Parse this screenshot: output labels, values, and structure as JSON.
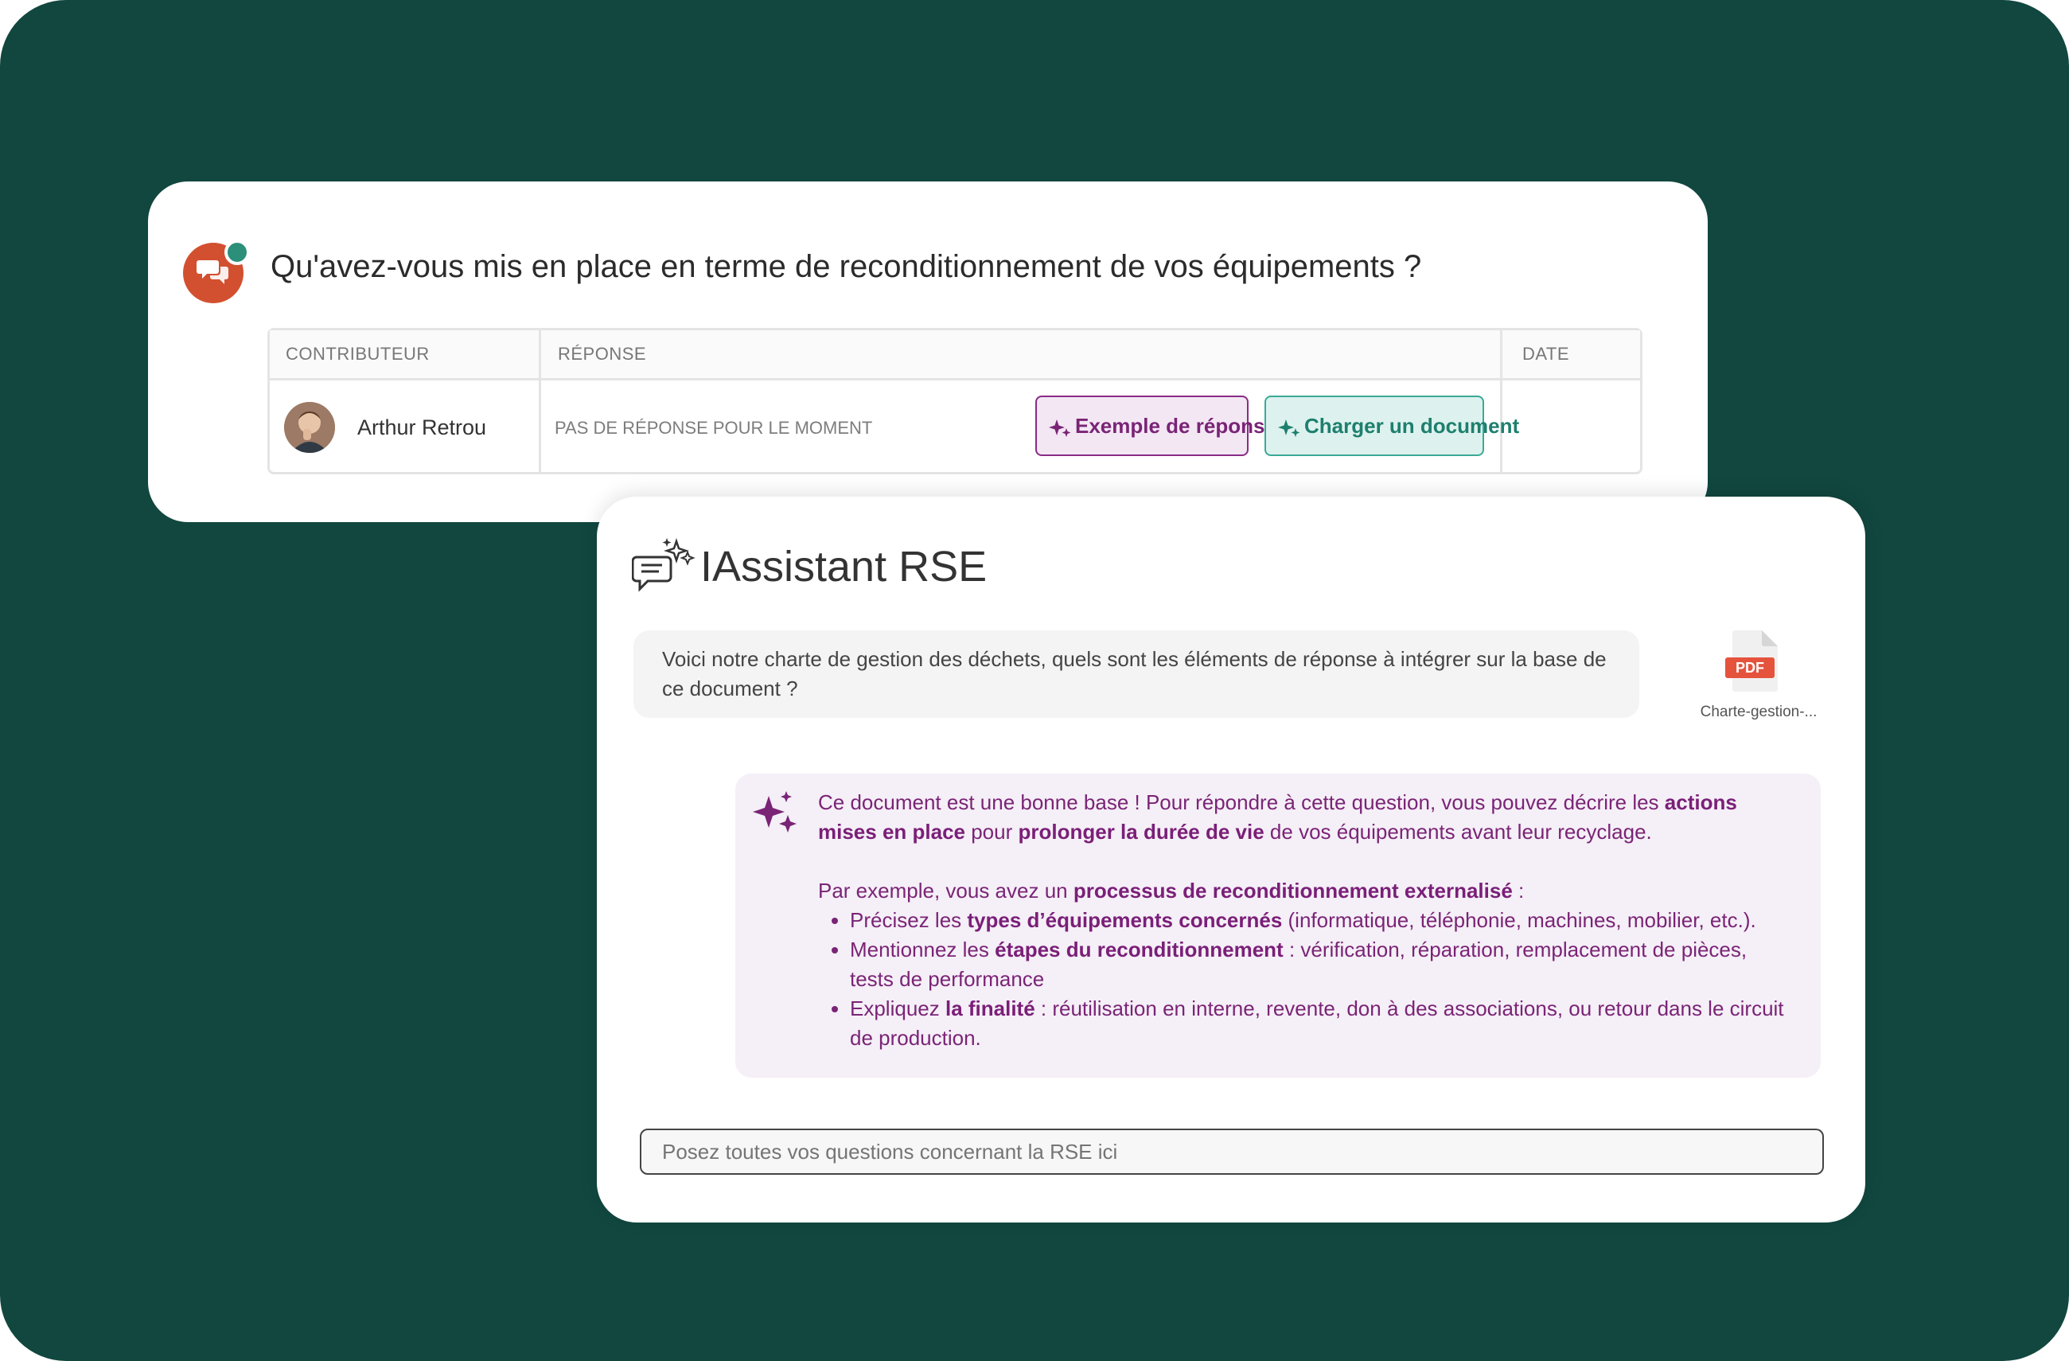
{
  "question": {
    "title": "Qu'avez-vous mis en place en terme de reconditionnement de vos équipements ?",
    "table": {
      "headers": [
        "CONTRIBUTEUR",
        "RÉPONSE",
        "DATE"
      ],
      "row": {
        "contributor": "Arthur Retrou",
        "response": "PAS DE RÉPONSE POUR LE MOMENT",
        "date": ""
      }
    },
    "buttons": {
      "example": "Exemple de réponse",
      "upload": "Charger un document"
    }
  },
  "assistant": {
    "title": "IAssistant RSE",
    "user_message": "Voici notre charte de gestion des déchets, quels sont les éléments de réponse à intégrer sur la base de ce document ?",
    "attachment": {
      "badge": "PDF",
      "filename": "Charte-gestion-..."
    },
    "reply": {
      "p1_a": "Ce document est une bonne base ! Pour répondre à cette question, vous pouvez décrire les ",
      "p1_b": "actions mises en place",
      "p1_c": " pour ",
      "p1_d": "prolonger la durée de vie",
      "p1_e": " de vos équipements avant leur recyclage.",
      "p2_a": "Par exemple, vous avez un ",
      "p2_b": "processus de reconditionnement externalisé",
      "p2_c": " :",
      "bullets": [
        {
          "a": "Précisez les ",
          "b": "types d’équipements concernés",
          "c": " (informatique, téléphonie, machines, mobilier, etc.)."
        },
        {
          "a": "Mentionnez les ",
          "b": "étapes du reconditionnement",
          "c": " : vérification, réparation, remplacement de pièces, tests de performance"
        },
        {
          "a": "Expliquez ",
          "b": "la finalité",
          "c": " : réutilisation en interne, revente, don à des associations, ou retour dans le circuit de production."
        }
      ]
    },
    "input_placeholder": "Posez toutes vos questions concernant la RSE ici"
  },
  "colors": {
    "background": "#11473f",
    "question_icon": "#d2502f",
    "accent_purple": "#7a2476",
    "accent_teal": "#1e7f6e"
  },
  "icons": [
    "chat-bubbles-icon",
    "sparkles-icon",
    "chat-sparkle-icon",
    "pdf-file-icon"
  ]
}
